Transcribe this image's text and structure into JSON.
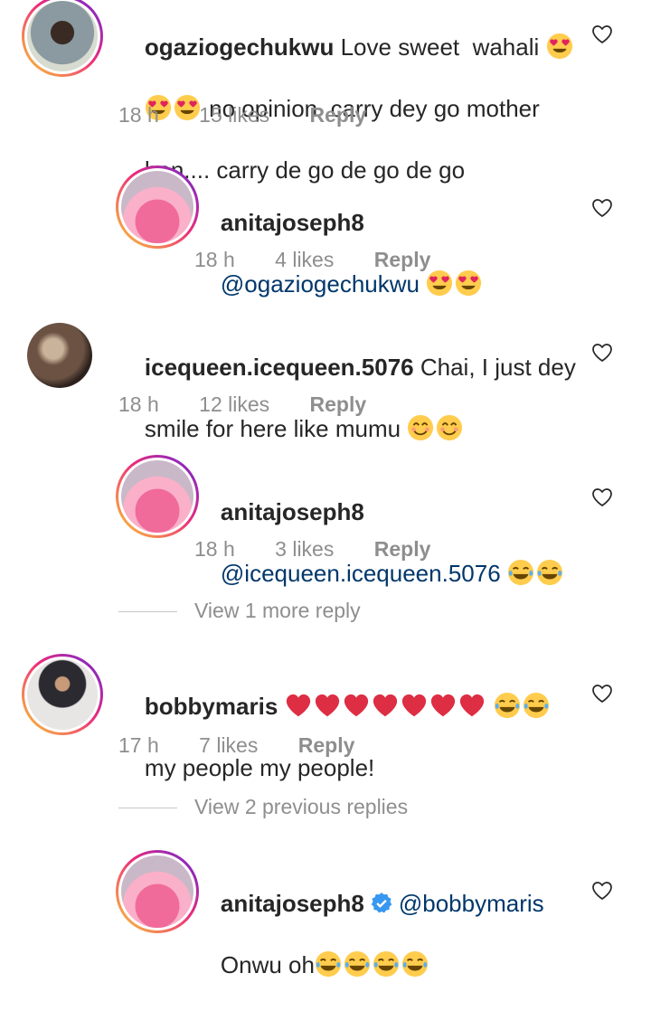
{
  "comments": [
    {
      "username": "ogaziogechukwu",
      "text_a": " Love sweet  wahali ",
      "text_b": " no opinion  carry dey go mother",
      "text_c": "hen.... carry de go de go de go",
      "time": "18 h",
      "likes": "15 likes",
      "reply": "Reply"
    },
    {
      "username": "anitajoseph8",
      "mention": "@ogaziogechukwu",
      "time": "18 h",
      "likes": "4 likes",
      "reply": "Reply"
    },
    {
      "username": "icequeen.icequeen.5076",
      "text_a": " Chai, I just dey",
      "text_b": "smile for here like mumu ",
      "time": "18 h",
      "likes": "12 likes",
      "reply": "Reply"
    },
    {
      "username": "anitajoseph8",
      "mention": "@icequeen.icequeen.5076",
      "time": "18 h",
      "likes": "3 likes",
      "reply": "Reply"
    },
    {
      "view_more": "View 1 more reply"
    },
    {
      "username": "bobbymaris",
      "text_b": "my people my people!",
      "time": "17 h",
      "likes": "7 likes",
      "reply": "Reply"
    },
    {
      "view_more": "View 2 previous replies"
    },
    {
      "username": "anitajoseph8",
      "mention": "@bobbymaris",
      "text_b": "Onwu oh"
    }
  ],
  "colors": {
    "text": "#262626",
    "meta": "#8e8e8e",
    "mention": "#00376b",
    "verified": "#3897f0"
  },
  "icons": [
    "heart-eyes-emoji",
    "tears-of-joy-emoji",
    "smiling-emoji",
    "red-heart-emoji",
    "heart-outline-icon",
    "verified-badge-icon"
  ]
}
